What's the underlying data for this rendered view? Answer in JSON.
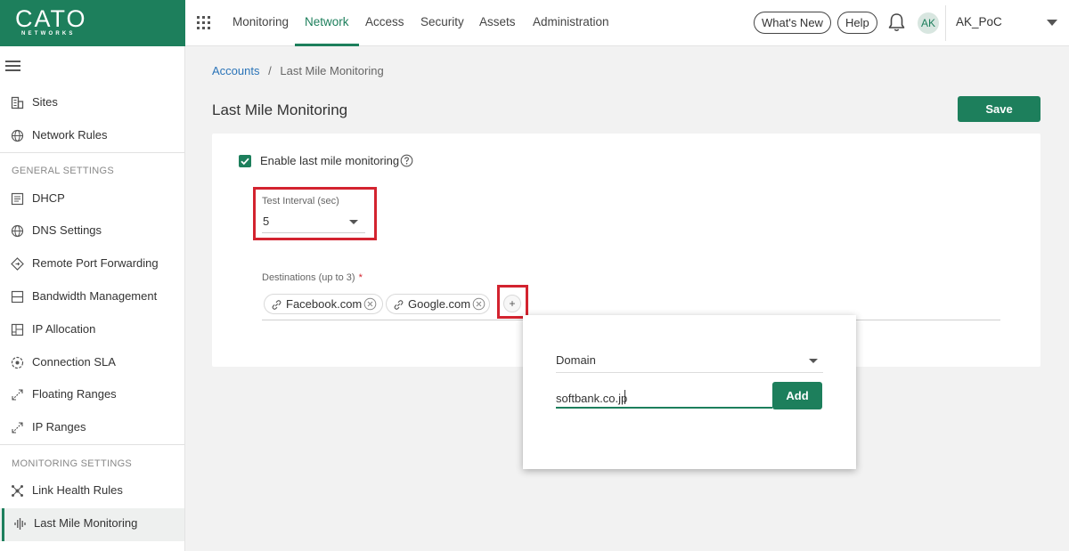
{
  "brand": {
    "logo_main": "CATO",
    "logo_sub": "NETWORKS",
    "color": "#1d7f5c"
  },
  "topnav": {
    "items": [
      {
        "label": "Monitoring",
        "active": false
      },
      {
        "label": "Network",
        "active": true
      },
      {
        "label": "Access",
        "active": false
      },
      {
        "label": "Security",
        "active": false
      },
      {
        "label": "Assets",
        "active": false
      },
      {
        "label": "Administration",
        "active": false
      }
    ],
    "whats_new": "What's New",
    "help": "Help",
    "avatar_initials": "AK",
    "username": "AK_PoC"
  },
  "sidebar": {
    "top_items": [
      {
        "label": "Sites",
        "icon": "building-icon"
      },
      {
        "label": "Network Rules",
        "icon": "globe-icon"
      }
    ],
    "general_title": "GENERAL SETTINGS",
    "general_items": [
      {
        "label": "DHCP",
        "icon": "document-icon"
      },
      {
        "label": "DNS Settings",
        "icon": "globe-icon"
      },
      {
        "label": "Remote Port Forwarding",
        "icon": "diamond-arrow-icon"
      },
      {
        "label": "Bandwidth Management",
        "icon": "bandwidth-icon"
      },
      {
        "label": "IP Allocation",
        "icon": "grid-icon"
      },
      {
        "label": "Connection SLA",
        "icon": "sla-icon"
      },
      {
        "label": "Floating Ranges",
        "icon": "expand-arrow-icon"
      },
      {
        "label": "IP Ranges",
        "icon": "expand-arrow-icon"
      }
    ],
    "monitoring_title": "MONITORING SETTINGS",
    "monitoring_items": [
      {
        "label": "Link Health Rules",
        "icon": "link-health-icon"
      },
      {
        "label": "Last Mile Monitoring",
        "icon": "waveform-icon",
        "active": true
      }
    ]
  },
  "breadcrumb": {
    "parent": "Accounts",
    "separator": "/",
    "current": "Last Mile Monitoring"
  },
  "page": {
    "title": "Last Mile Monitoring",
    "save_label": "Save"
  },
  "form": {
    "enable_label": "Enable last mile monitoring",
    "enable_checked": true,
    "interval_label": "Test Interval (sec)",
    "interval_value": "5",
    "destinations_label": "Destinations (up to 3)",
    "destinations_required": "*",
    "destinations": [
      "Facebook.com",
      "Google.com"
    ],
    "add_symbol": "+"
  },
  "popup": {
    "type_value": "Domain",
    "domain_value": "softbank.co.jp",
    "add_label": "Add"
  },
  "highlight_color": "#d3232f"
}
